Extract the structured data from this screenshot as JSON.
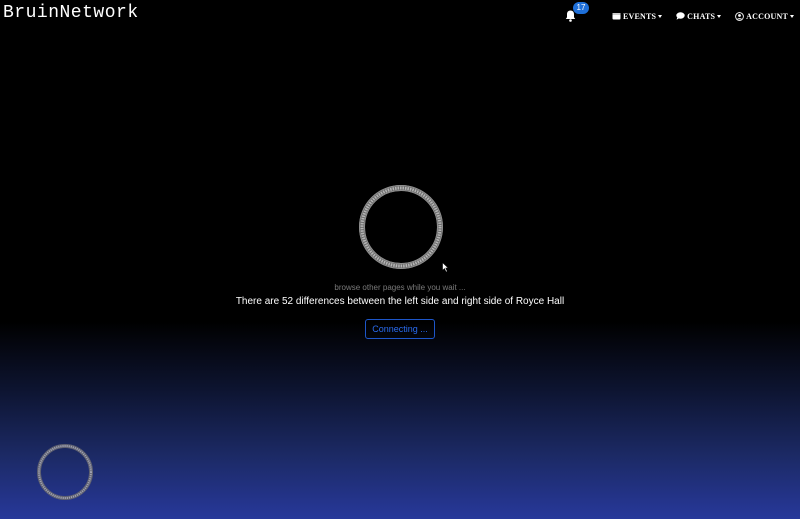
{
  "nav": {
    "brand": "BruinNetwork",
    "notifications_count": "17",
    "events_label": "EVENTS",
    "chats_label": "CHATS",
    "account_label": "ACCOUNT"
  },
  "loading": {
    "hint": "browse other pages while you wait ...",
    "fact": "There are 52 differences between the left side and right side of Royce Hall",
    "button_label": "Connecting ..."
  },
  "colors": {
    "accent": "#1e6fd9",
    "button_border": "#1d56c9",
    "button_text": "#2a6cf0",
    "gradient_bottom": "#27389a"
  },
  "icons": {
    "notifications": "bell-icon",
    "events": "calendar-icon",
    "chats": "chat-bubble-icon",
    "account": "user-circle-icon",
    "loading": "spinner-ring-icon"
  }
}
